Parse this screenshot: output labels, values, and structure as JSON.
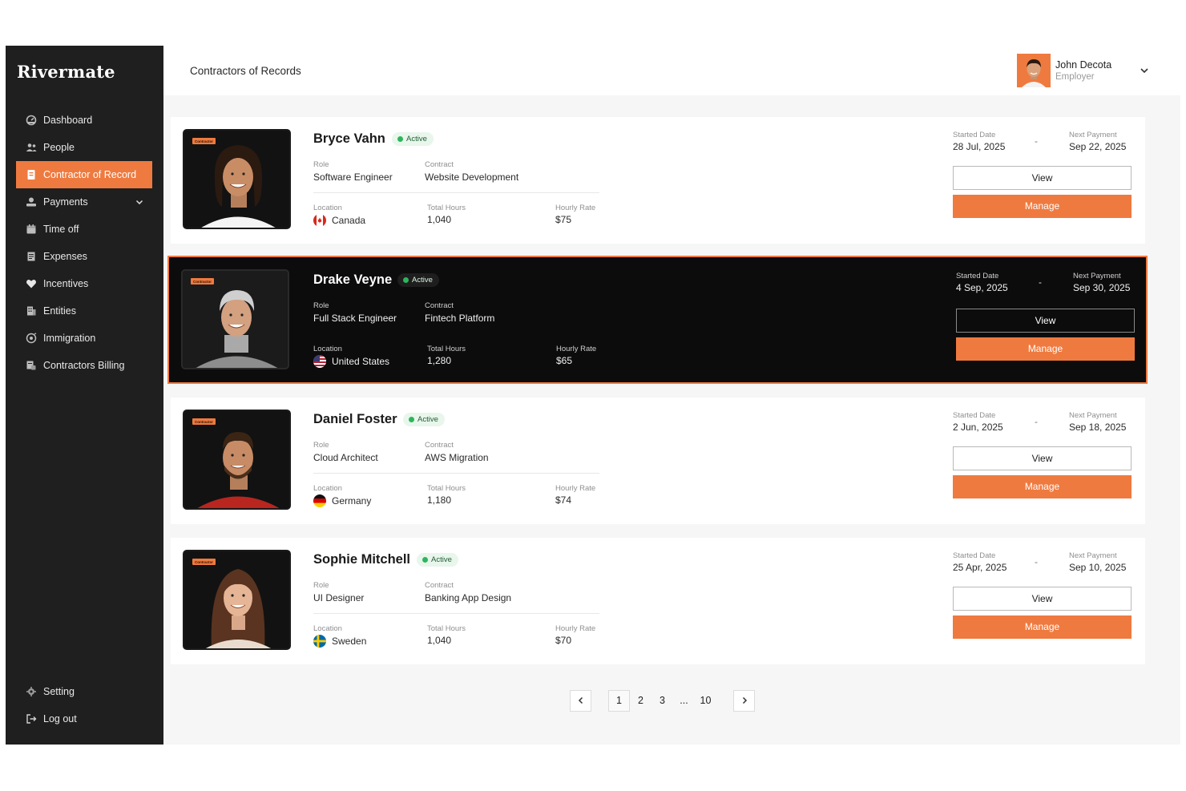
{
  "brand": "Rivermate",
  "header": {
    "title": "Contractors of Records",
    "user": {
      "name": "John Decota",
      "role": "Employer"
    }
  },
  "sidebar": {
    "items": [
      {
        "label": "Dashboard",
        "icon": "dashboard-icon"
      },
      {
        "label": "People",
        "icon": "people-icon"
      },
      {
        "label": "Contractor of Record",
        "icon": "contract-icon",
        "active": true
      },
      {
        "label": "Payments",
        "icon": "payments-icon"
      },
      {
        "label": "Time off",
        "icon": "calendar-icon"
      },
      {
        "label": "Expenses",
        "icon": "receipt-icon"
      },
      {
        "label": "Incentives",
        "icon": "heart-icon"
      },
      {
        "label": "Entities",
        "icon": "building-icon"
      },
      {
        "label": "Immigration",
        "icon": "globe-icon"
      },
      {
        "label": "Contractors Billing",
        "icon": "billing-icon"
      }
    ],
    "bottom": [
      {
        "label": "Setting",
        "icon": "gear-icon"
      },
      {
        "label": "Log out",
        "icon": "logout-icon"
      }
    ]
  },
  "labels": {
    "role": "Role",
    "contract": "Contract",
    "location": "Location",
    "total_hours": "Total Hours",
    "hourly_rate": "Hourly Rate",
    "started_date": "Started Date",
    "next_payment": "Next Payment",
    "view": "View",
    "manage": "Manage",
    "tag": "Contractor",
    "dash": "-"
  },
  "contractors": [
    {
      "name": "Bryce Vahn",
      "status": "Active",
      "role": "Software Engineer",
      "contract": "Website Development",
      "location": "Canada",
      "total_hours": "1,040",
      "hourly_rate": "$75",
      "started": "28 Jul, 2025",
      "next_payment": "Sep 22, 2025"
    },
    {
      "name": "Drake Veyne",
      "status": "Active",
      "role": "Full Stack Engineer",
      "contract": "Fintech Platform",
      "location": "United States",
      "total_hours": "1,280",
      "hourly_rate": "$65",
      "started": "4 Sep, 2025",
      "next_payment": "Sep 30, 2025"
    },
    {
      "name": "Daniel Foster",
      "status": "Active",
      "role": "Cloud Architect",
      "contract": "AWS Migration",
      "location": "Germany",
      "total_hours": "1,180",
      "hourly_rate": "$74",
      "started": "2 Jun, 2025",
      "next_payment": "Sep 18, 2025"
    },
    {
      "name": "Sophie Mitchell",
      "status": "Active",
      "role": "UI Designer",
      "contract": "Banking App Design",
      "location": "Sweden",
      "total_hours": "1,040",
      "hourly_rate": "$70",
      "started": "25 Apr, 2025",
      "next_payment": "Sep 10, 2025"
    }
  ],
  "pagination": {
    "pages": [
      "1",
      "2",
      "3",
      "...",
      "10"
    ],
    "current": "1"
  },
  "colors": {
    "accent": "#ef7a3f",
    "sidebar": "#1f1f1f",
    "active_dot": "#2db55d"
  }
}
